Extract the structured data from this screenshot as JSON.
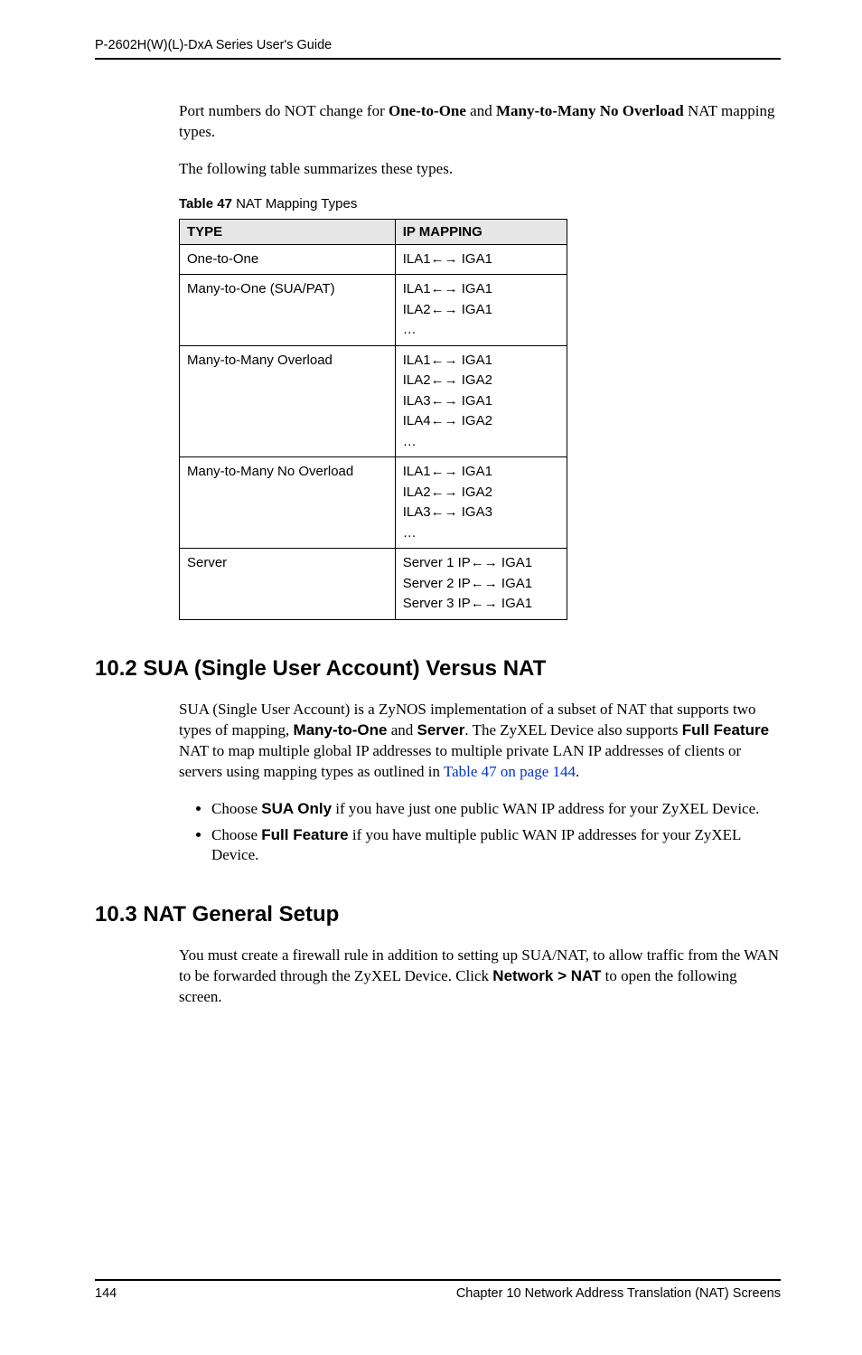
{
  "header": {
    "title": "P-2602H(W)(L)-DxA Series User's Guide"
  },
  "intro": {
    "p1_pre": "Port numbers do NOT change for ",
    "p1_b1": "One-to-One",
    "p1_mid": " and ",
    "p1_b2": "Many-to-Many No Overload",
    "p1_post": " NAT mapping types.",
    "p2": "The following table summarizes these types."
  },
  "table": {
    "caption_bold": "Table 47",
    "caption_rest": "   NAT Mapping Types",
    "headers": {
      "col1": "TYPE",
      "col2": "IP MAPPING"
    },
    "rows": [
      {
        "type": "One-to-One",
        "mapping": "ILA1←→ IGA1"
      },
      {
        "type": "Many-to-One (SUA/PAT)",
        "mapping": "ILA1←→ IGA1\nILA2←→ IGA1\n…"
      },
      {
        "type": "Many-to-Many Overload",
        "mapping": "ILA1←→ IGA1\nILA2←→ IGA2\nILA3←→ IGA1\nILA4←→ IGA2\n…"
      },
      {
        "type": "Many-to-Many No Overload",
        "mapping": "ILA1←→ IGA1\nILA2←→ IGA2\nILA3←→ IGA3\n…"
      },
      {
        "type": "Server",
        "mapping": "Server 1 IP←→ IGA1\nServer 2 IP←→ IGA1\nServer 3 IP←→ IGA1"
      }
    ]
  },
  "sec102": {
    "heading": "10.2  SUA (Single User Account) Versus NAT",
    "p_a": "SUA (Single User Account) is a ZyNOS implementation of a subset of NAT that supports two types of mapping, ",
    "p_b1": "Many-to-One",
    "p_mid1": " and ",
    "p_b2": "Server",
    "p_mid2": ". The ZyXEL Device also supports ",
    "p_b3": "Full Feature",
    "p_c": " NAT to map multiple global IP addresses to multiple private LAN IP addresses of clients or servers using mapping types as outlined in ",
    "p_link": "Table 47 on page 144",
    "p_end": ".",
    "bullet1_a": "Choose ",
    "bullet1_b": "SUA Only",
    "bullet1_c": " if you have just one public WAN IP address for your ZyXEL Device.",
    "bullet2_a": "Choose ",
    "bullet2_b": "Full Feature",
    "bullet2_c": " if you have multiple public WAN IP addresses for your ZyXEL Device."
  },
  "sec103": {
    "heading": "10.3  NAT General Setup",
    "p_a": "You must create a firewall rule in addition to setting up SUA/NAT, to allow traffic from the WAN to be forwarded through the ZyXEL Device. Click ",
    "p_b": "Network > NAT",
    "p_c": " to open the following screen."
  },
  "footer": {
    "page": "144",
    "chapter": "Chapter 10 Network Address Translation (NAT) Screens"
  }
}
